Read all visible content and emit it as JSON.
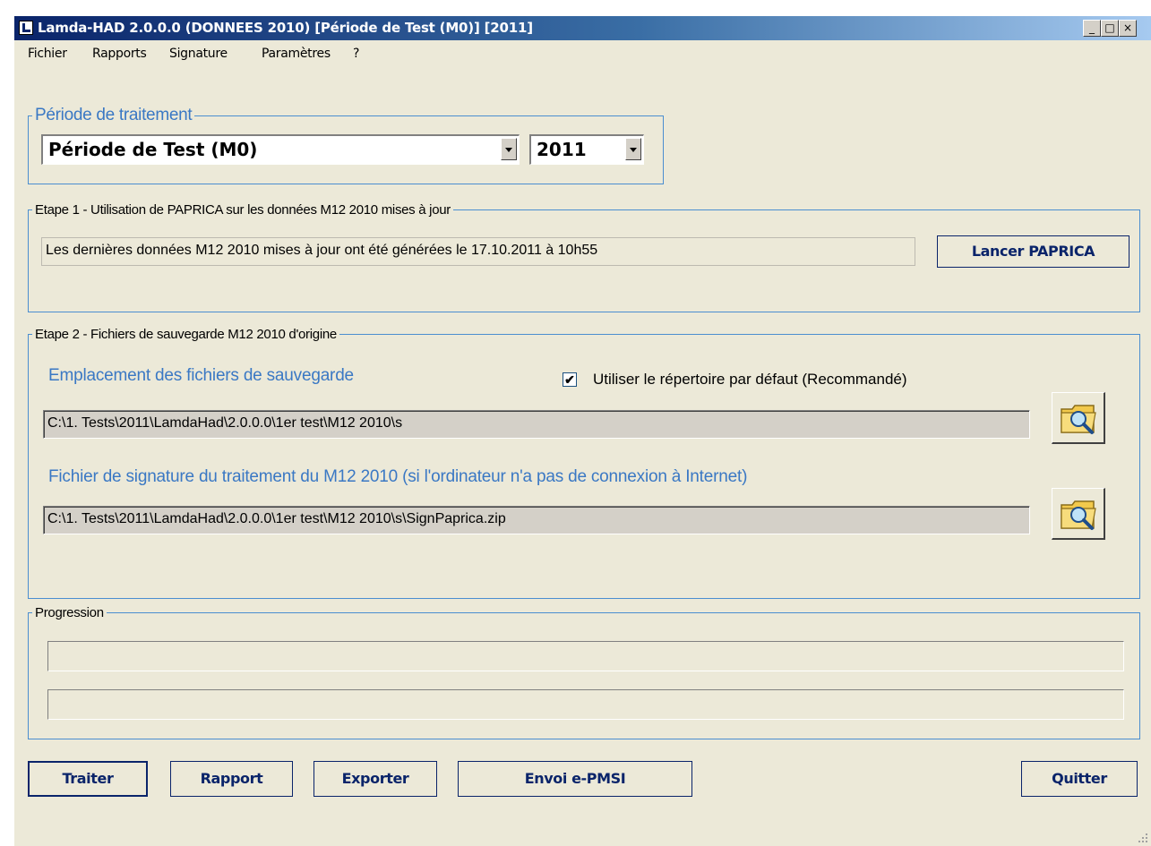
{
  "window": {
    "title": "Lamda-HAD 2.0.0.0 (DONNEES 2010) [Période de Test (M0)] [2011]",
    "controls": {
      "minimize": "_",
      "maximize": "□",
      "close": "×"
    }
  },
  "menu": [
    "Fichier",
    "Rapports",
    "Signature",
    "Paramètres",
    "?"
  ],
  "periode": {
    "legend": "Période de traitement",
    "period_value": "Période de Test (M0)",
    "year_value": "2011"
  },
  "etape1": {
    "legend": "Etape 1 - Utilisation de PAPRICA sur les données M12 2010 mises à jour",
    "status": "Les dernières données M12 2010 mises à jour ont été générées le 17.10.2011 à 10h55",
    "button": "Lancer PAPRICA"
  },
  "etape2": {
    "legend": "Etape 2 - Fichiers de sauvegarde M12 2010 d'origine",
    "location_title": "Emplacement des fichiers de sauvegarde",
    "default_dir_checkbox": {
      "label": "Utiliser le répertoire par défaut (Recommandé)",
      "checked": true
    },
    "location_path": "C:\\1. Tests\\2011\\LamdaHad\\2.0.0.0\\1er test\\M12 2010\\s",
    "signature_title": "Fichier de signature du traitement du M12 2010 (si l'ordinateur n'a pas de connexion à Internet)",
    "signature_path": "C:\\1. Tests\\2011\\LamdaHad\\2.0.0.0\\1er test\\M12 2010\\s\\SignPaprica.zip"
  },
  "progression": {
    "legend": "Progression"
  },
  "buttons": {
    "traiter": "Traiter",
    "rapport": "Rapport",
    "exporter": "Exporter",
    "envoi": "Envoi e-PMSI",
    "quitter": "Quitter"
  },
  "colors": {
    "title_gradient_start": "#0a246a",
    "accent_blue": "#3a78c4",
    "frame_blue": "#4b8ed0",
    "window_bg": "#ece9d8"
  },
  "icons": {
    "app": "app-icon",
    "browse": "folder-search-icon",
    "check": "check-icon",
    "grip": "resize-grip-icon"
  }
}
